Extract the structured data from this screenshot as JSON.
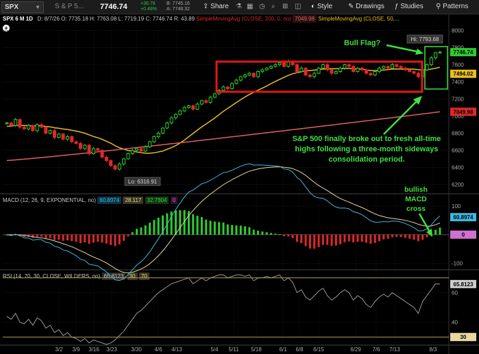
{
  "toolbar": {
    "symbol": "SPX",
    "description": "S & P 5...",
    "last": "7746.74",
    "change": "+36.78",
    "change_pct": "+0.48%",
    "bid": "B: 7745.16",
    "ask": "A: 7748.32",
    "buttons": [
      "Share",
      "Style",
      "Drawings",
      "Studies",
      "Patterns"
    ]
  },
  "header": {
    "title": "SPX 6 M 1D",
    "ohlc": [
      "D: 8/7/26",
      "O: 7735.18",
      "H: 7763.08",
      "L: 7719.19",
      "C: 7746.74",
      "R: 43.89"
    ],
    "study1": "SimpleMovingAvg (CLOSE, 200, 0, no)",
    "study1_value": "7049.98",
    "study2": "SimpleMovingAvg (CLOSE, 50,..."
  },
  "macd_header": {
    "label": "MACD (12, 26, 9, EXPONENTIAL, no)",
    "value": "60.8974",
    "avg": "28.117",
    "diff": "32.7804",
    "zero": "0"
  },
  "rsi_header": {
    "label": "RSI (14, 70, 30, CLOSE, WILDERS, no)",
    "value": "65.8123",
    "ob": "30",
    "os": "70"
  },
  "annotations": {
    "bull_flag": "Bull Flag?",
    "breakout": [
      "S&P 500 finally broke out to fresh all-time",
      "highs following a three-month sideways",
      "consolidation period."
    ],
    "macd_cross": [
      "bullish",
      "MACD",
      "cross"
    ],
    "hi": "Hi: 7793.68",
    "lo": "Lo: 6316.91"
  },
  "colors": {
    "up": "#2ecc2e",
    "down": "#e02828",
    "sma50": "#e8c020",
    "sma200": "#e06060",
    "macd": "#40b8e0",
    "macd_avg": "#e8d8a0",
    "rsi": "#999999",
    "box": "#e01818",
    "annot": "#40e040"
  },
  "chart_data": [
    {
      "type": "candlestick",
      "title": "SPX 6 M 1D",
      "ylim": [
        6100,
        8100
      ],
      "y_ticks": [
        6200,
        6400,
        6600,
        6800,
        7000,
        7200,
        7400,
        7600,
        7800,
        8000
      ],
      "x_ticks": [
        "3/2",
        "3/9",
        "3/16",
        "3/23",
        "3/30",
        "4/6",
        "4/13",
        "5/4",
        "5/11",
        "5/18",
        "6/1",
        "6/8",
        "6/15",
        "6/29",
        "7/6",
        "7/13",
        "8/3"
      ],
      "price_labels": [
        {
          "value": 7746.74,
          "text": "7746.74",
          "color": "#2ecc2e"
        },
        {
          "value": 7494.02,
          "text": "7494.02",
          "color": "#e8c020"
        },
        {
          "value": 7049.98,
          "text": "7049.98",
          "color": "#e02828"
        }
      ],
      "closes": [
        6920,
        6890,
        6960,
        6870,
        6850,
        6890,
        6830,
        6900,
        6870,
        6800,
        6830,
        6750,
        6790,
        6730,
        6760,
        6700,
        6680,
        6620,
        6660,
        6560,
        6620,
        6600,
        6520,
        6480,
        6420,
        6380,
        6440,
        6500,
        6560,
        6600,
        6620,
        6590,
        6640,
        6700,
        6760,
        6800,
        6860,
        6920,
        6980,
        7020,
        7060,
        7100,
        7120,
        7080,
        7140,
        7180,
        7160,
        7220,
        7260,
        7300,
        7340,
        7320,
        7380,
        7420,
        7460,
        7480,
        7500,
        7460,
        7520,
        7540,
        7560,
        7580,
        7600,
        7620,
        7580,
        7640,
        7600,
        7520,
        7560,
        7480,
        7460,
        7500,
        7560,
        7600,
        7540,
        7500,
        7520,
        7560,
        7600,
        7580,
        7520,
        7560,
        7540,
        7500,
        7480,
        7520,
        7560,
        7580,
        7560,
        7600,
        7580,
        7560,
        7540,
        7520,
        7500,
        7460,
        7540,
        7600,
        7680,
        7740,
        7747
      ],
      "sma50": {
        "start": 6880,
        "end": 7494.02
      },
      "sma200": {
        "start": 6480,
        "end": 7049.98
      }
    },
    {
      "type": "bar",
      "title": "MACD (12, 26, 9, EXPONENTIAL, no)",
      "y_ticks": [
        100,
        -100
      ],
      "ylim": [
        -120,
        140
      ],
      "series": [
        {
          "name": "MACD",
          "last": 60.8974
        },
        {
          "name": "Avg",
          "last": 28.117
        },
        {
          "name": "Diff",
          "last": 32.7804
        }
      ]
    },
    {
      "type": "line",
      "title": "RSI (14, 70, 30, CLOSE, WILDERS, no)",
      "ylim": [
        25,
        75
      ],
      "y_ticks": [
        60,
        40
      ],
      "levels": [
        70,
        30
      ],
      "last": 65.8123,
      "values": [
        44,
        42,
        46,
        40,
        39,
        42,
        38,
        43,
        41,
        36,
        38,
        33,
        35,
        31,
        33,
        30,
        29,
        27,
        29,
        26,
        28,
        27,
        26,
        25,
        26,
        28,
        31,
        34,
        38,
        42,
        46,
        48,
        51,
        54,
        57,
        60,
        62,
        64,
        66,
        67,
        68,
        69,
        70,
        66,
        68,
        70,
        68,
        70,
        71,
        72,
        72,
        70,
        71,
        72,
        72,
        71,
        72,
        68,
        70,
        70,
        71,
        70,
        71,
        72,
        68,
        70,
        67,
        60,
        62,
        57,
        55,
        58,
        61,
        63,
        58,
        55,
        57,
        60,
        62,
        60,
        55,
        58,
        56,
        52,
        50,
        54,
        57,
        59,
        57,
        60,
        58,
        56,
        54,
        52,
        50,
        46,
        54,
        58,
        62,
        66,
        65.8
      ]
    }
  ]
}
